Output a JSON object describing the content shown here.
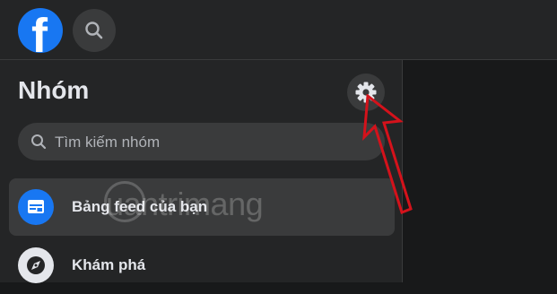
{
  "header": {
    "logo": {
      "glyph": "f",
      "color": "#1877f2",
      "icon": "facebook-logo-icon"
    },
    "search": {
      "icon": "search-icon"
    }
  },
  "sidebar": {
    "title": "Nhóm",
    "settings": {
      "icon": "gear-icon"
    },
    "search": {
      "placeholder": "Tìm kiếm nhóm",
      "value": "",
      "icon": "search-icon"
    },
    "items": [
      {
        "label": "Bảng feed của bạn",
        "icon": "feed-icon",
        "active": true,
        "icon_color": "#1877f2"
      },
      {
        "label": "Khám phá",
        "icon": "compass-icon",
        "active": false,
        "icon_color": "#e4e6eb"
      }
    ]
  },
  "annotation": {
    "arrow_color": "#d4121b"
  },
  "watermark": {
    "text": "uantrimang"
  }
}
